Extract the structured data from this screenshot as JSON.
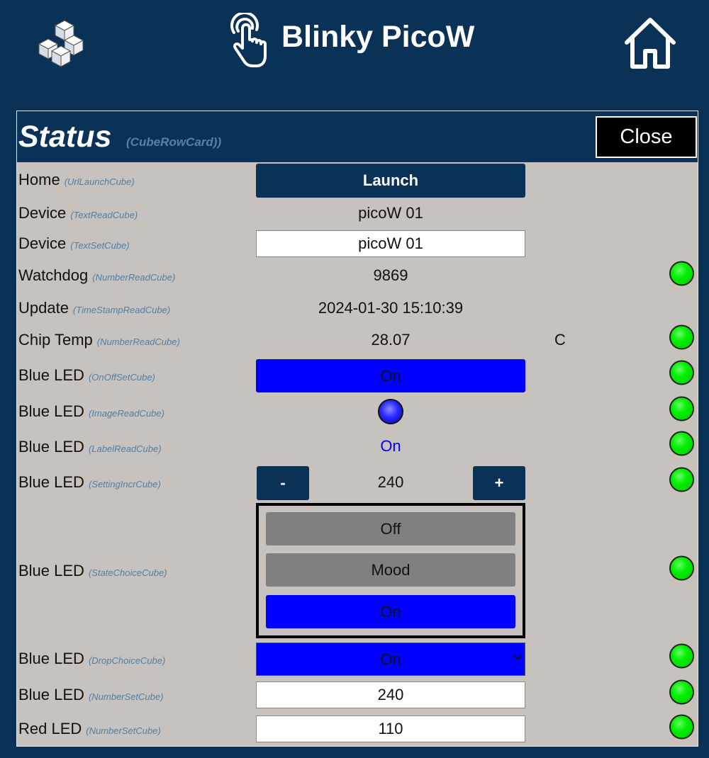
{
  "header": {
    "title": "Blinky PicoW",
    "logo_icon": "cube-stack-logo",
    "touch_icon": "touch-hand-icon",
    "home_icon": "home-icon"
  },
  "card": {
    "title": "Status",
    "subtitle": "(CubeRowCard))",
    "close_label": "Close"
  },
  "rows": [
    {
      "label": "Home",
      "type": "(UrlLaunchCube)",
      "value": "Launch"
    },
    {
      "label": "Device",
      "type": "(TextReadCube)",
      "value": "picoW 01"
    },
    {
      "label": "Device",
      "type": "(TextSetCube)",
      "value": "picoW 01"
    },
    {
      "label": "Watchdog",
      "type": "(NumberReadCube)",
      "value": "9869",
      "status": "green"
    },
    {
      "label": "Update",
      "type": "(TimeStampReadCube)",
      "value": "2024-01-30 15:10:39"
    },
    {
      "label": "Chip Temp",
      "type": "(NumberReadCube)",
      "value": "28.07",
      "unit": "C",
      "status": "green"
    },
    {
      "label": "Blue LED",
      "type": "(OnOffSetCube)",
      "value": "On",
      "status": "green"
    },
    {
      "label": "Blue LED",
      "type": "(ImageReadCube)",
      "status": "green"
    },
    {
      "label": "Blue LED",
      "type": "(LabelReadCube)",
      "value": "On",
      "status": "green"
    },
    {
      "label": "Blue LED",
      "type": "(SettingIncrCube)",
      "value": "240",
      "minus": "-",
      "plus": "+",
      "status": "green"
    },
    {
      "label": "Blue LED",
      "type": "(StateChoiceCube)",
      "choices": [
        "Off",
        "Mood",
        "On"
      ],
      "selected": "On",
      "status": "green"
    },
    {
      "label": "Blue LED",
      "type": "(DropChoiceCube)",
      "value": "On",
      "status": "green"
    },
    {
      "label": "Blue LED",
      "type": "(NumberSetCube)",
      "value": "240",
      "status": "green"
    },
    {
      "label": "Red LED",
      "type": "(NumberSetCube)",
      "value": "110",
      "status": "green"
    }
  ],
  "colors": {
    "navy": "#0a3156",
    "card_bg": "#c7c2bd",
    "blue": "#0000ff",
    "status_green": "#00dd00"
  }
}
